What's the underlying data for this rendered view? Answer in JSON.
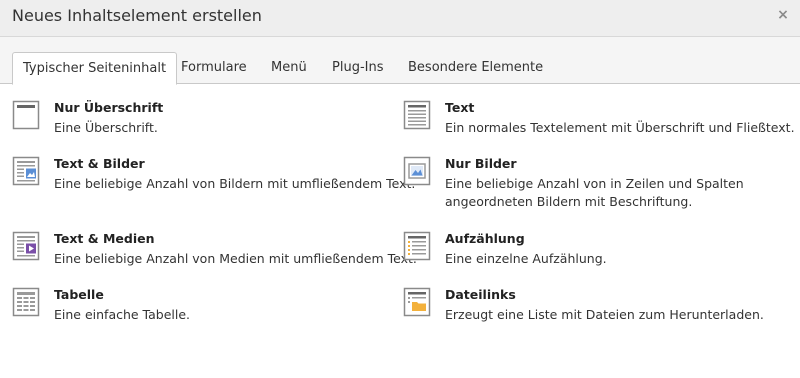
{
  "dialog": {
    "title": "Neues Inhaltselement erstellen",
    "close_label": "×"
  },
  "tabs": [
    {
      "label": "Typischer Seiteninhalt",
      "active": true
    },
    {
      "label": "Formulare",
      "active": false
    },
    {
      "label": "Menü",
      "active": false
    },
    {
      "label": "Plug-Ins",
      "active": false
    },
    {
      "label": "Besondere Elemente",
      "active": false
    }
  ],
  "elements": {
    "header_only": {
      "name": "Nur Überschrift",
      "description": "Eine Überschrift.",
      "icon": "header-icon"
    },
    "text": {
      "name": "Text",
      "description": "Ein normales Textelement mit Überschrift und Fließtext.",
      "icon": "text-icon"
    },
    "text_images": {
      "name": "Text & Bilder",
      "description": "Eine beliebige Anzahl von Bildern mit umfließendem Text.",
      "icon": "text-image-icon"
    },
    "images_only": {
      "name": "Nur Bilder",
      "description_line1": "Eine beliebige Anzahl von in Zeilen und Spalten",
      "description_line2": "angeordneten Bildern mit Beschriftung.",
      "icon": "image-icon"
    },
    "text_media": {
      "name": "Text & Medien",
      "description": "Eine beliebige Anzahl von Medien mit umfließendem Text.",
      "icon": "text-media-icon"
    },
    "bullets": {
      "name": "Aufzählung",
      "description": "Eine einzelne Aufzählung.",
      "icon": "bullet-list-icon"
    },
    "table": {
      "name": "Tabelle",
      "description": "Eine einfache Tabelle.",
      "icon": "table-icon"
    },
    "uploads": {
      "name": "Dateilinks",
      "description": "Erzeugt eine Liste mit Dateien zum Herunterladen.",
      "icon": "file-links-icon"
    }
  },
  "colors": {
    "icon_border": "#8a8a8a",
    "icon_lines": "#9a9a9a",
    "image_blue": "#5b8fd6",
    "media_purple": "#7a4fa8",
    "folder_orange": "#f3b13c"
  }
}
